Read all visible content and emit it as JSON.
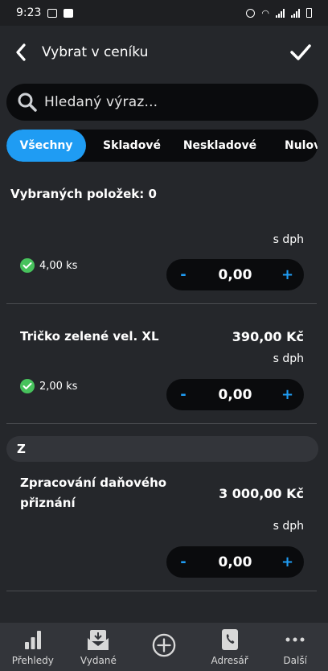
{
  "status_bar": {
    "time": "9:23"
  },
  "header": {
    "title": "Vybrat v ceníku"
  },
  "search": {
    "placeholder": "Hledaný výraz..."
  },
  "tabs": [
    {
      "label": "Všechny",
      "active": true
    },
    {
      "label": "Skladové",
      "active": false
    },
    {
      "label": "Neskladové",
      "active": false
    },
    {
      "label": "Nulov",
      "active": false
    }
  ],
  "selected_count": "Vybraných položek: 0",
  "items": [
    {
      "name": "",
      "price": "",
      "vat": "s dph",
      "stock": "4,00 ks",
      "quantity": "0,00"
    },
    {
      "name": "Tričko zelené vel. XL",
      "price": "390,00 Kč",
      "vat": "s dph",
      "stock": "2,00 ks",
      "quantity": "0,00"
    }
  ],
  "section": {
    "letter": "Z"
  },
  "section_items": [
    {
      "name": "Zpracování daňového přiznání",
      "price": "3 000,00 Kč",
      "vat": "s dph",
      "quantity": "0,00"
    }
  ],
  "stepper": {
    "minus": "-",
    "plus": "+"
  },
  "bottom_nav": [
    {
      "label": "Přehledy",
      "icon": "chart-icon"
    },
    {
      "label": "Vydané",
      "icon": "invoice-icon"
    },
    {
      "label": "",
      "icon": "add-circle-icon"
    },
    {
      "label": "Adresář",
      "icon": "contacts-icon"
    },
    {
      "label": "Další",
      "icon": "more-icon"
    }
  ],
  "colors": {
    "accent": "#1f9cf3",
    "background": "#25272b",
    "check": "#47c25c",
    "field": "#0a0b0d"
  }
}
